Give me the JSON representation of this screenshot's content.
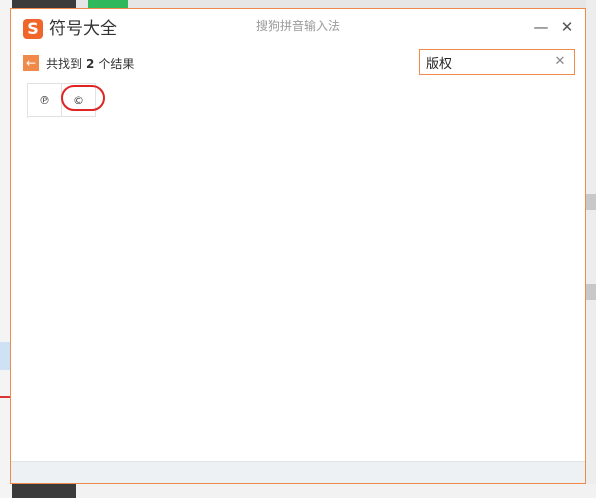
{
  "window": {
    "app_title": "符号大全",
    "center_title": "搜狗拼音输入法",
    "logo_letter": "S",
    "minimize_glyph": "—",
    "close_glyph": "✕"
  },
  "results": {
    "prefix": "共找到",
    "count": "2",
    "suffix": "个结果",
    "back_icon": "←"
  },
  "search": {
    "value": "版权",
    "clear_glyph": "✕"
  },
  "symbols": [
    "℗",
    "©"
  ],
  "colors": {
    "accent": "#f08a4b",
    "logo": "#f0662a",
    "highlight": "#e02424"
  }
}
